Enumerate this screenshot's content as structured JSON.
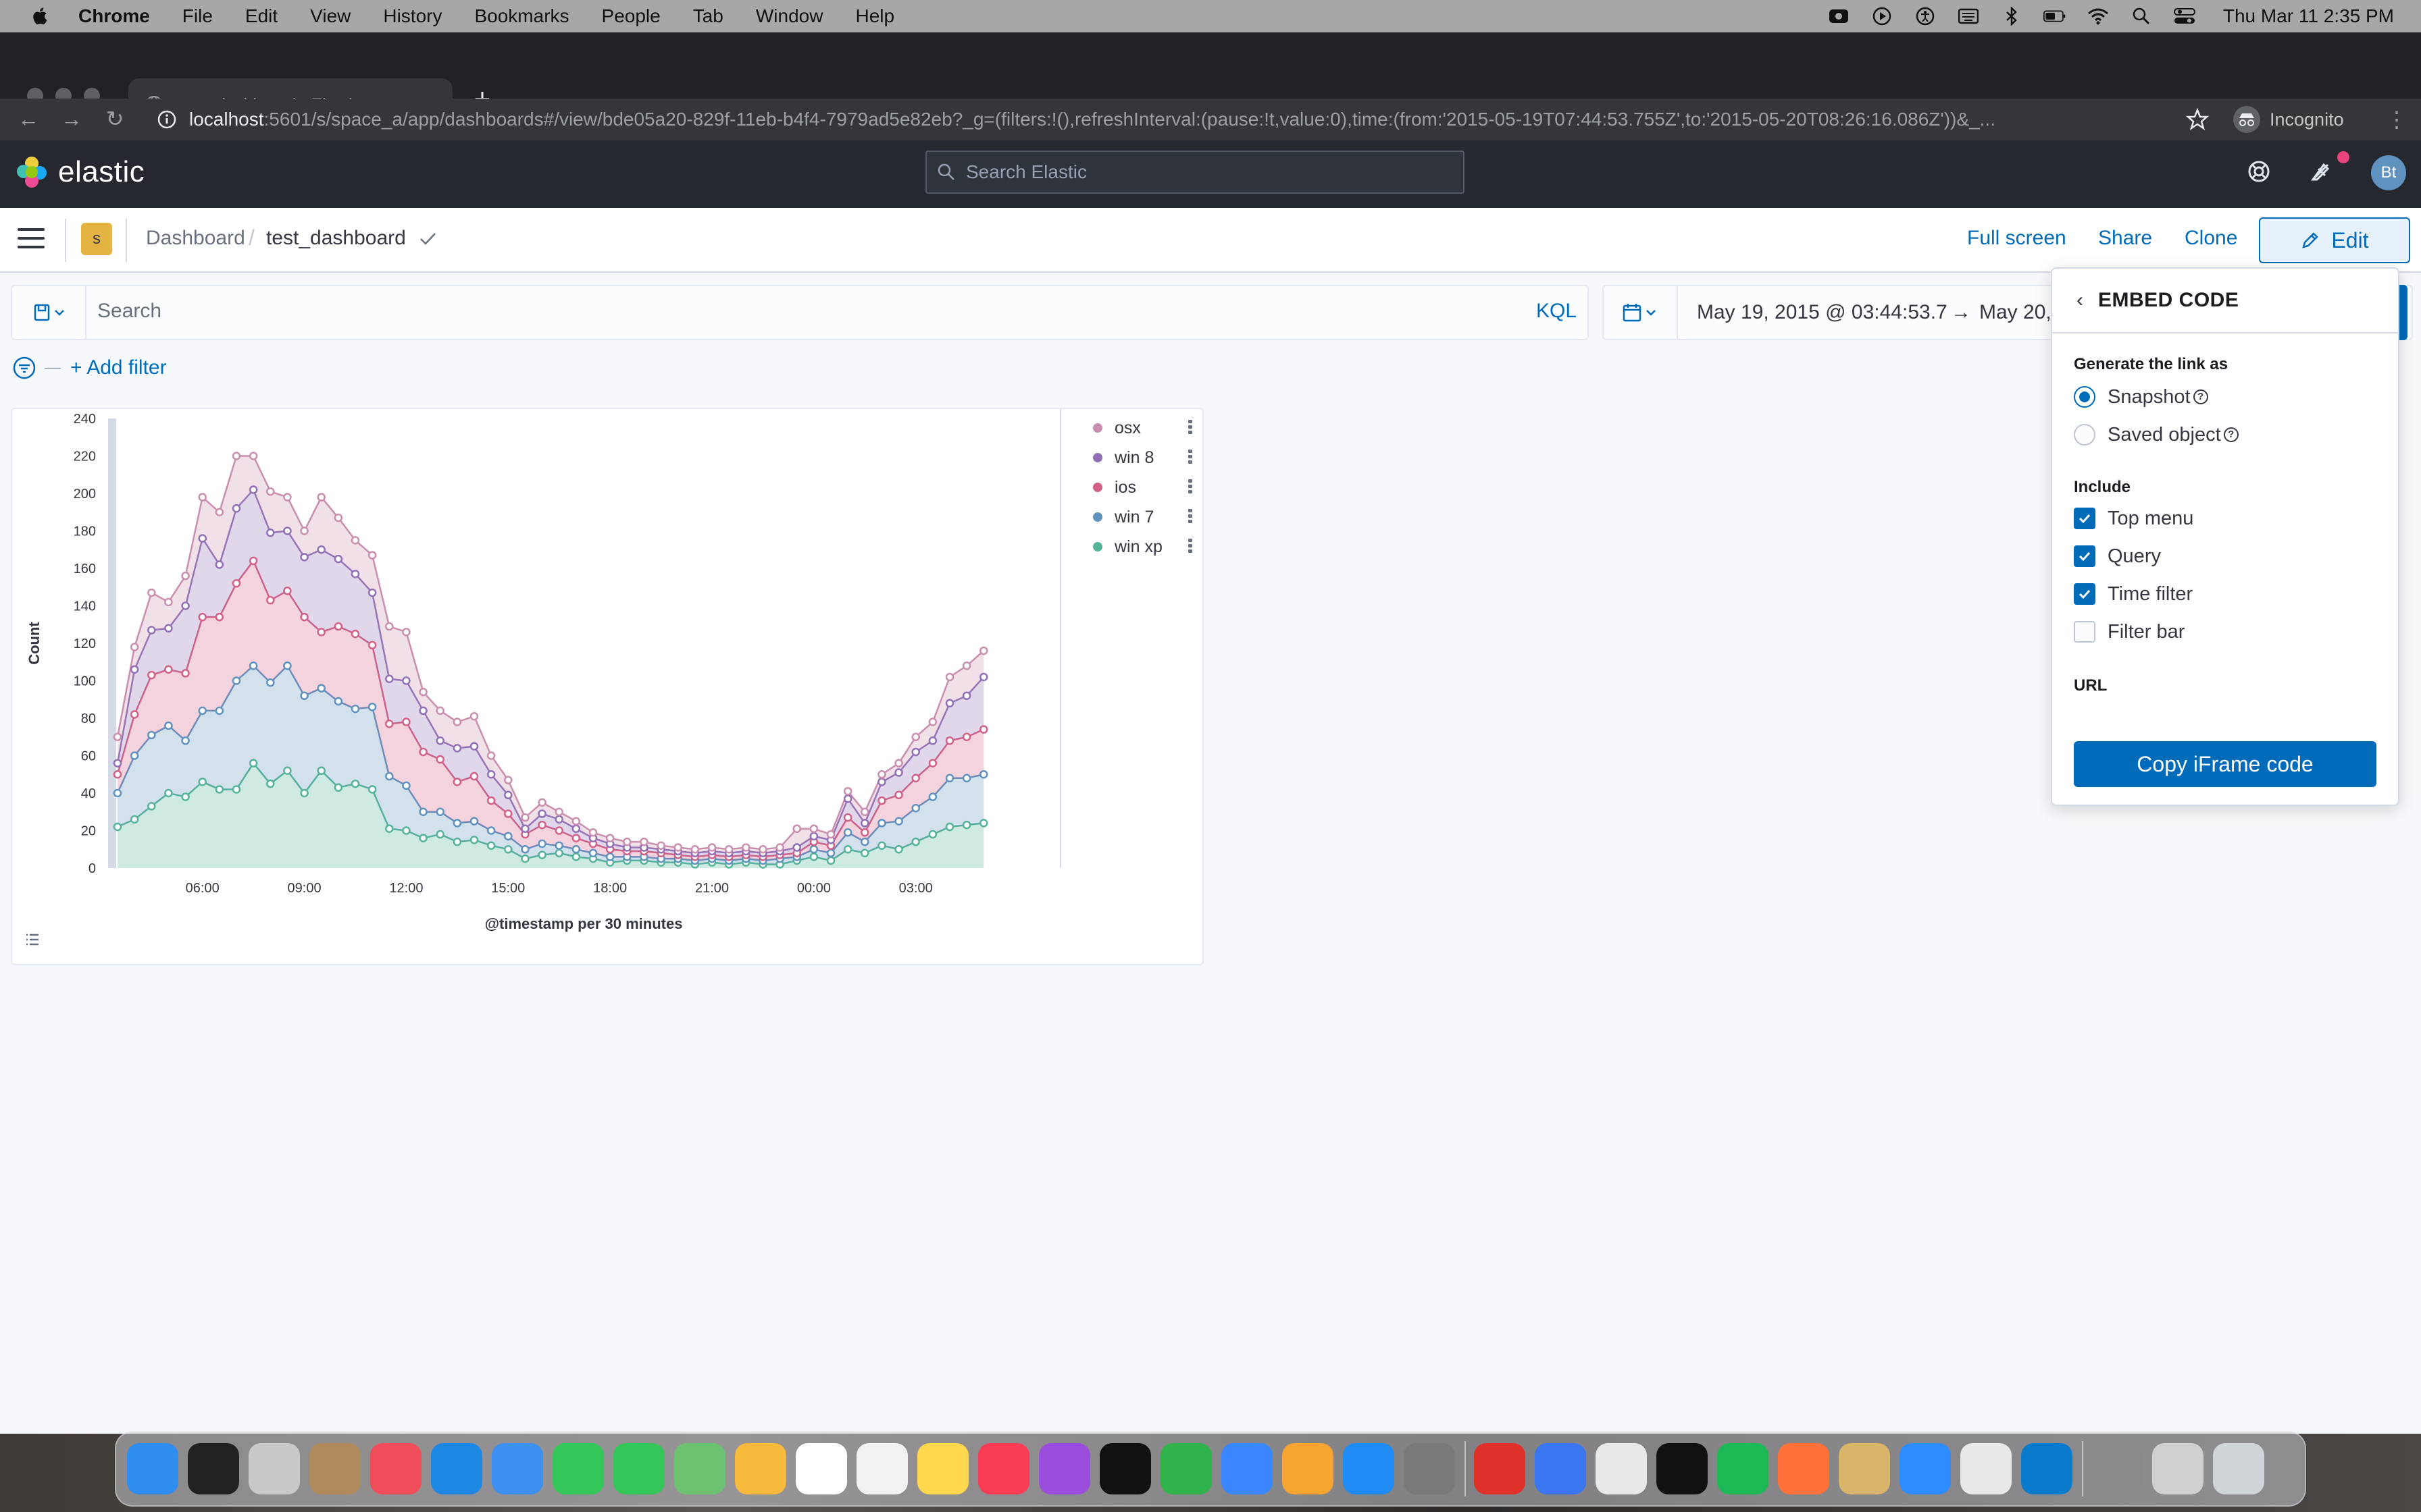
{
  "menubar": {
    "app_name": "Chrome",
    "items": [
      "File",
      "Edit",
      "View",
      "History",
      "Bookmarks",
      "People",
      "Tab",
      "Window",
      "Help"
    ],
    "clock": "Thu Mar 11  2:35 PM"
  },
  "browser": {
    "tab_title": "test_dashboard - Elastic",
    "url_host": "localhost",
    "url_rest": ":5601/s/space_a/app/dashboards#/view/bde05a20-829f-11eb-b4f4-7979ad5e82eb?_g=(filters:!(),refreshInterval:(pause:!t,value:0),time:(from:'2015-05-19T07:44:53.755Z',to:'2015-05-20T08:26:16.086Z'))&_...",
    "incognito_label": "Incognito"
  },
  "kibana_header": {
    "logo_text": "elastic",
    "search_placeholder": "Search Elastic",
    "avatar_initials": "Bt"
  },
  "breadcrumbs": {
    "space_initial": "s",
    "items": [
      "Dashboard",
      "test_dashboard"
    ]
  },
  "top_nav": {
    "full_screen": "Full screen",
    "share": "Share",
    "clone": "Clone",
    "edit": "Edit"
  },
  "query_bar": {
    "placeholder": "Search",
    "language": "KQL",
    "date_start": "May 19, 2015 @ 03:44:53.7",
    "date_arrow": "→",
    "date_end": "May 20,"
  },
  "filter": {
    "add_filter": "+ Add filter"
  },
  "chart_data": {
    "type": "area",
    "stacked": true,
    "xlabel": "@timestamp per 30 minutes",
    "ylabel": "Count",
    "ylim": [
      0,
      240
    ],
    "yticks": [
      0,
      20,
      40,
      60,
      80,
      100,
      120,
      140,
      160,
      180,
      200,
      220,
      240
    ],
    "x_tick_labels": [
      "06:00",
      "09:00",
      "12:00",
      "15:00",
      "18:00",
      "21:00",
      "00:00",
      "03:00"
    ],
    "x_tick_index": [
      5,
      11,
      17,
      23,
      29,
      35,
      41,
      47
    ],
    "legend_position": "right",
    "series": [
      {
        "name": "win xp",
        "color": "#54b399",
        "values": [
          22,
          26,
          33,
          40,
          38,
          46,
          42,
          42,
          56,
          45,
          52,
          40,
          52,
          43,
          45,
          42,
          21,
          20,
          16,
          18,
          14,
          15,
          12,
          10,
          5,
          7,
          8,
          6,
          5,
          3,
          4,
          4,
          3,
          3,
          2,
          3,
          2,
          3,
          2,
          2,
          4,
          6,
          4,
          10,
          8,
          12,
          10,
          14,
          18,
          22,
          23,
          24
        ]
      },
      {
        "name": "win 7",
        "color": "#6092c0",
        "values": [
          18,
          34,
          38,
          36,
          30,
          38,
          42,
          58,
          52,
          54,
          56,
          52,
          44,
          46,
          40,
          44,
          28,
          24,
          14,
          12,
          10,
          10,
          8,
          7,
          5,
          6,
          4,
          4,
          3,
          3,
          2,
          2,
          2,
          2,
          2,
          2,
          2,
          2,
          2,
          3,
          2,
          4,
          4,
          9,
          6,
          12,
          15,
          18,
          20,
          26,
          25,
          26
        ]
      },
      {
        "name": "ios",
        "color": "#d36086",
        "values": [
          10,
          22,
          32,
          30,
          36,
          50,
          50,
          52,
          56,
          44,
          40,
          42,
          30,
          40,
          40,
          33,
          28,
          34,
          32,
          28,
          22,
          24,
          16,
          12,
          8,
          10,
          8,
          6,
          5,
          4,
          3,
          3,
          3,
          2,
          2,
          2,
          2,
          2,
          2,
          2,
          2,
          4,
          4,
          8,
          5,
          12,
          14,
          16,
          18,
          20,
          22,
          24
        ]
      },
      {
        "name": "win 8",
        "color": "#9170b8",
        "values": [
          6,
          24,
          24,
          22,
          36,
          42,
          28,
          40,
          38,
          36,
          32,
          32,
          44,
          36,
          32,
          28,
          24,
          22,
          22,
          10,
          18,
          16,
          14,
          10,
          3,
          6,
          6,
          5,
          3,
          3,
          2,
          2,
          2,
          2,
          2,
          2,
          2,
          2,
          2,
          2,
          3,
          3,
          3,
          10,
          5,
          10,
          12,
          14,
          12,
          20,
          22,
          28
        ]
      },
      {
        "name": "osx",
        "color": "#ca8eae",
        "values": [
          14,
          12,
          20,
          14,
          16,
          22,
          28,
          28,
          18,
          22,
          18,
          14,
          28,
          22,
          18,
          20,
          28,
          26,
          10,
          16,
          14,
          16,
          10,
          8,
          6,
          6,
          4,
          4,
          3,
          3,
          3,
          3,
          2,
          2,
          2,
          2,
          2,
          2,
          2,
          2,
          10,
          4,
          3,
          4,
          6,
          4,
          5,
          8,
          10,
          14,
          16,
          14
        ]
      }
    ]
  },
  "legend": {
    "items": [
      {
        "name": "osx",
        "color": "#ca8eae"
      },
      {
        "name": "win 8",
        "color": "#9170b8"
      },
      {
        "name": "ios",
        "color": "#d36086"
      },
      {
        "name": "win 7",
        "color": "#6092c0"
      },
      {
        "name": "win xp",
        "color": "#54b399"
      }
    ]
  },
  "share_popover": {
    "title": "EMBED CODE",
    "generate_label": "Generate the link as",
    "snapshot": "Snapshot",
    "saved_object": "Saved object",
    "include_label": "Include",
    "top_menu": "Top menu",
    "query": "Query",
    "time_filter": "Time filter",
    "filter_bar": "Filter bar",
    "url_label": "URL",
    "copy_button": "Copy iFrame code"
  },
  "colors": {
    "accent": "#006bb8",
    "header_bg": "#25282f",
    "space_badge": "#e4b342"
  }
}
